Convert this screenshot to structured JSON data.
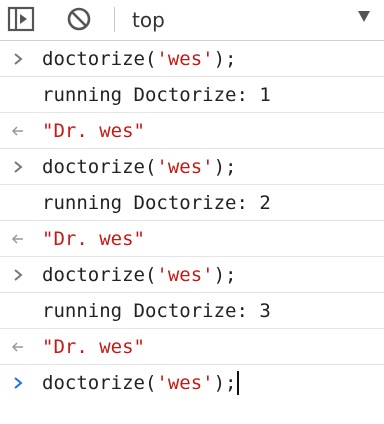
{
  "toolbar": {
    "sidebar_icon": "sidebar-toggle-icon",
    "clear_icon": "clear-console-icon",
    "context": "top",
    "context_arrow_icon": "dropdown-arrow-icon"
  },
  "console": {
    "entries": [
      {
        "type": "input",
        "func": "doctorize(",
        "arg": "'wes'",
        "tail": ");"
      },
      {
        "type": "log",
        "text": "running Doctorize: 1"
      },
      {
        "type": "result",
        "value": "\"Dr. wes\""
      },
      {
        "type": "input",
        "func": "doctorize(",
        "arg": "'wes'",
        "tail": ");"
      },
      {
        "type": "log",
        "text": "running Doctorize: 2"
      },
      {
        "type": "result",
        "value": "\"Dr. wes\""
      },
      {
        "type": "input",
        "func": "doctorize(",
        "arg": "'wes'",
        "tail": ");"
      },
      {
        "type": "log",
        "text": "running Doctorize: 3"
      },
      {
        "type": "result",
        "value": "\"Dr. wes\""
      }
    ],
    "prompt": {
      "func": "doctorize(",
      "arg": "'wes'",
      "tail": ");"
    }
  },
  "colors": {
    "string": "#c41a16",
    "prompt_chevron": "#1a73e8",
    "input_chevron": "#777777",
    "result_arrow": "#999999"
  }
}
